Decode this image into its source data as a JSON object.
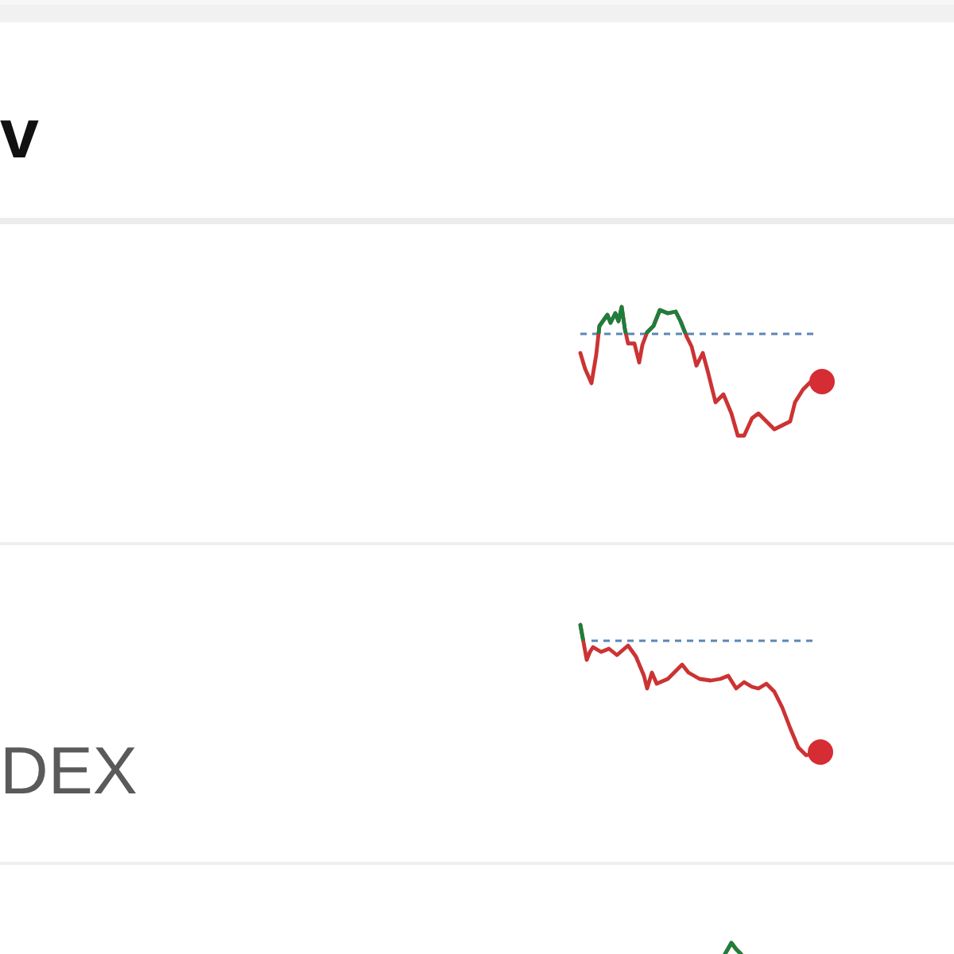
{
  "header": {
    "title": "v"
  },
  "rows": [
    {
      "kind": "sparkline"
    },
    {
      "name": "DEX",
      "kind": "sparkline"
    },
    {
      "kind": "sparkline"
    }
  ]
}
